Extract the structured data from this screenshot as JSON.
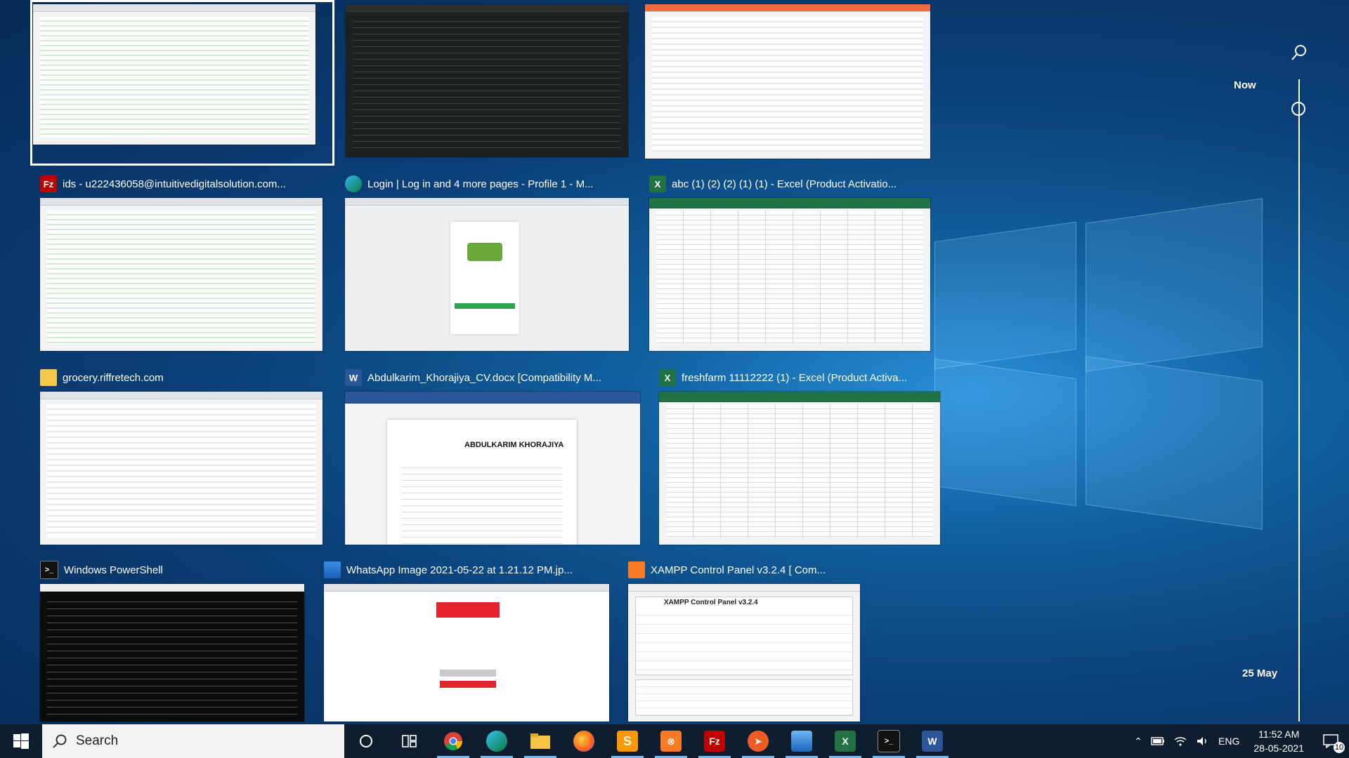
{
  "timeline": {
    "now_label": "Now",
    "date_label": "25 May"
  },
  "windows": [
    {
      "app": "whatsapp",
      "title": "",
      "icon": "whatsapp-icon",
      "selected": true
    },
    {
      "app": "sublime",
      "title": "",
      "icon": "sublime-icon"
    },
    {
      "app": "postman",
      "title": "",
      "icon": "postman-icon"
    },
    {
      "app": "filezilla",
      "title": "ids - u222436058@intuitivedigitalsolution.com...",
      "icon": "filezilla-icon",
      "icon_text": "Fz"
    },
    {
      "app": "edge",
      "title": "Login | Log in and 4 more pages - Profile 1 - M...",
      "icon": "edge-icon"
    },
    {
      "app": "excel",
      "title": "abc (1) (2) (2) (1) (1) - Excel (Product Activatio...",
      "icon": "excel-icon",
      "icon_text": "X"
    },
    {
      "app": "explorer",
      "title": "grocery.riffretech.com",
      "icon": "folder-icon"
    },
    {
      "app": "word",
      "title": "Abdulkarim_Khorajiya_CV.docx [Compatibility M...",
      "icon": "word-icon",
      "icon_text": "W",
      "doc_heading": "ABDULKARIM KHORAJIYA"
    },
    {
      "app": "excel",
      "title": "freshfarm 11112222 (1) - Excel (Product Activa...",
      "icon": "excel-icon",
      "icon_text": "X"
    },
    {
      "app": "powershell",
      "title": "Windows PowerShell",
      "icon": "powershell-icon",
      "icon_text": ">_"
    },
    {
      "app": "photos",
      "title": "WhatsApp Image 2021-05-22 at 1.21.12 PM.jp...",
      "icon": "photos-icon"
    },
    {
      "app": "xampp",
      "title": "XAMPP Control Panel v3.2.4   [ Com...",
      "icon": "xampp-icon",
      "panel_heading": "XAMPP Control Panel v3.2.4"
    }
  ],
  "taskbar": {
    "search_placeholder": "Search",
    "pinned": [
      {
        "name": "cortana-icon"
      },
      {
        "name": "task-view-icon"
      },
      {
        "name": "chrome-icon"
      },
      {
        "name": "edge-icon"
      },
      {
        "name": "file-explorer-icon"
      },
      {
        "name": "firefox-icon"
      },
      {
        "name": "sublime-text-icon"
      },
      {
        "name": "xampp-icon"
      },
      {
        "name": "filezilla-icon",
        "text": "Fz"
      },
      {
        "name": "postman-icon"
      },
      {
        "name": "photos-icon"
      },
      {
        "name": "excel-icon",
        "text": "X"
      },
      {
        "name": "powershell-icon"
      },
      {
        "name": "word-icon",
        "text": "W"
      }
    ],
    "language": "ENG",
    "time": "11:52 AM",
    "date": "28-05-2021",
    "notification_count": "10"
  },
  "colors": {
    "accent": "#76b9ed",
    "excel": "#217346",
    "word": "#2b579a",
    "filezilla": "#bf0000",
    "xampp": "#fb7a24"
  }
}
